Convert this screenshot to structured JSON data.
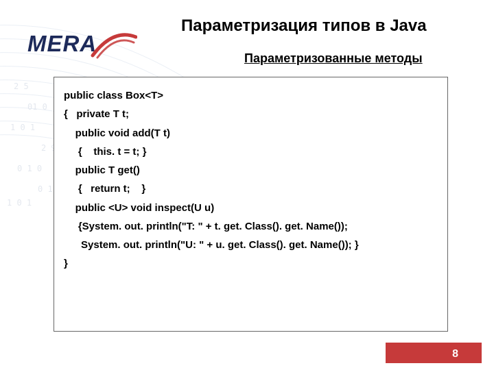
{
  "logo": {
    "text": "MERA"
  },
  "title": "Параметризация типов в Java",
  "subtitle": "Параметризованные методы",
  "code": {
    "l1": "public class Box<T>",
    "l2": "{   private T t;",
    "l3": "    public void add(T t)",
    "l4": "     {    this. t = t; }",
    "l5": "    public T get()",
    "l6": "     {   return t;    }",
    "l7": "    public <U> void inspect(U u)",
    "l8": "     {System. out. println(\"T: \" + t. get. Class(). get. Name());",
    "l9": "      System. out. println(\"U: \" + u. get. Class(). get. Name()); }",
    "l10": "}"
  },
  "pagenum": "8"
}
